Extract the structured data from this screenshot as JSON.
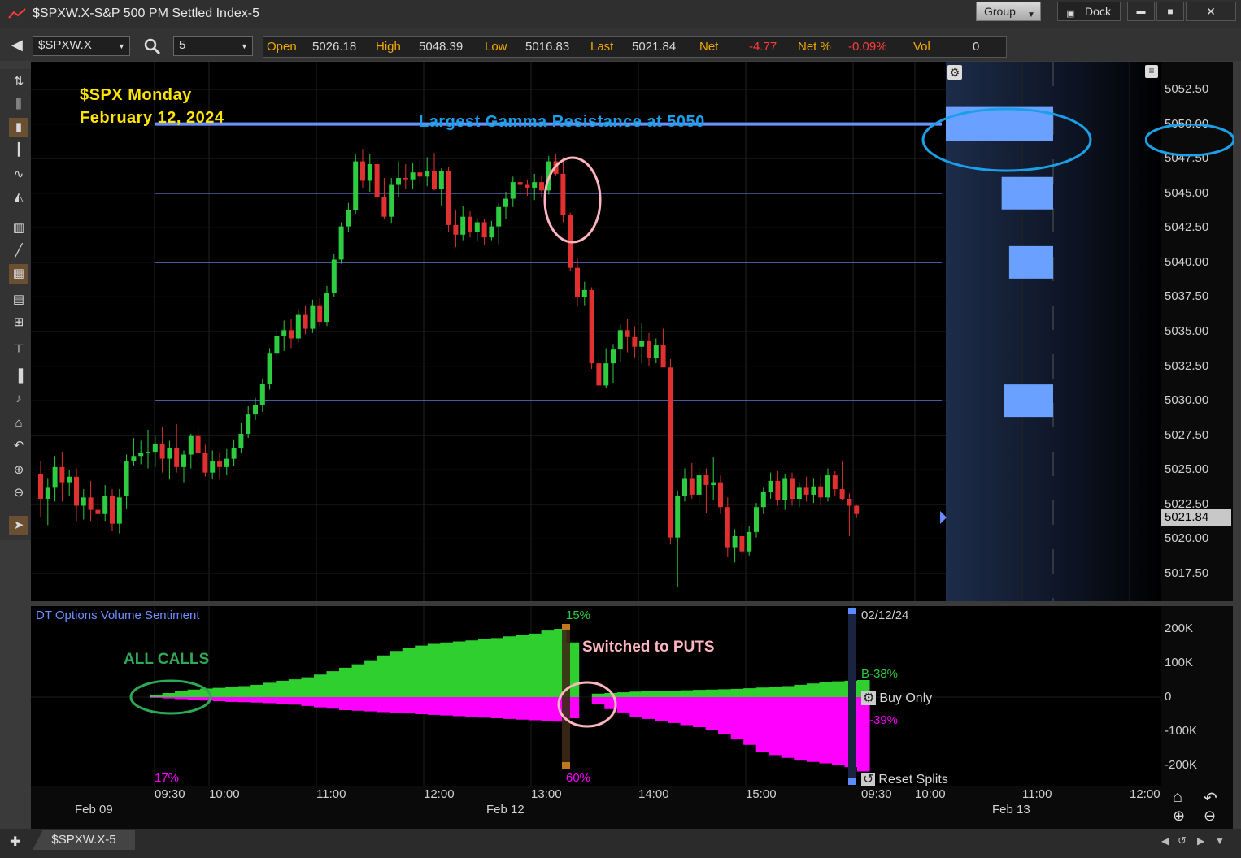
{
  "window": {
    "title": "$SPXW.X-S&P 500 PM Settled Index-5",
    "group_label": "Group",
    "dock_label": "Dock",
    "minimize": "▬",
    "maximize": "■",
    "close": "✕"
  },
  "toolbar": {
    "symbol": "$SPXW.X",
    "interval": "5",
    "quote": {
      "open_label": "Open",
      "open": "5026.18",
      "high_label": "High",
      "high": "5048.39",
      "low_label": "Low",
      "low": "5016.83",
      "last_label": "Last",
      "last": "5021.84",
      "net_label": "Net",
      "net": "-4.77",
      "netpct_label": "Net %",
      "netpct": "-0.09%",
      "vol_label": "Vol",
      "vol": "0"
    }
  },
  "annotations": {
    "title_line1": "$SPX Monday",
    "title_line2": "February 12, 2024",
    "gamma": "Largest Gamma Resistance at 5050",
    "all_calls": "ALL CALLS",
    "switched": "Switched to PUTS"
  },
  "price_axis": {
    "ticks": [
      "5052.50",
      "5050.00",
      "5047.50",
      "5045.00",
      "5042.50",
      "5040.00",
      "5037.50",
      "5035.00",
      "5032.50",
      "5030.00",
      "5027.50",
      "5025.00",
      "5022.50",
      "5020.00",
      "5017.50"
    ],
    "last_badge": "5021.84"
  },
  "sentiment": {
    "title": "DT Options Volume Sentiment",
    "pct_top": "15%",
    "pct_17": "17%",
    "pct_60": "60%",
    "date": "02/12/24",
    "b_green": "B-38%",
    "b_magenta": "B-39%",
    "buy_only": "Buy Only",
    "reset": "Reset Splits",
    "axis": [
      "200K",
      "100K",
      "0",
      "-100K",
      "-200K"
    ]
  },
  "time_axis": {
    "labels": [
      "09:30",
      "10:00",
      "11:00",
      "12:00",
      "13:00",
      "14:00",
      "15:00",
      "09:30",
      "10:00",
      "11:00",
      "12:00"
    ],
    "dates": [
      "Feb 09",
      "Feb 12",
      "Feb 13"
    ]
  },
  "bottom": {
    "tab": "$SPXW.X-5"
  },
  "colors": {
    "up": "#2ecc40",
    "down": "#e03030",
    "levels": "#6f8fff",
    "gamma_bar": "#6aa0ff",
    "calls": "#30cf30",
    "puts": "#ff00ff",
    "ellipse_blue": "#1aa0e8",
    "ellipse_pink": "#ffb6c1",
    "ellipse_green": "#2eaa55"
  },
  "chart_data": {
    "type": "candlestick",
    "price_range": [
      5015.5,
      5054.5
    ],
    "gamma_levels": [
      {
        "price": 5050,
        "size": 1.0
      },
      {
        "price": 5045,
        "size": 0.48
      },
      {
        "price": 5040,
        "size": 0.41
      },
      {
        "price": 5030,
        "size": 0.46
      }
    ],
    "candles": [
      [
        5024.7,
        5025.6,
        5021.6,
        5022.9
      ],
      [
        5022.9,
        5024.4,
        5021.0,
        5023.7
      ],
      [
        5023.7,
        5026.0,
        5022.7,
        5025.2
      ],
      [
        5025.2,
        5026.3,
        5022.7,
        5024.1
      ],
      [
        5024.1,
        5025.0,
        5023.1,
        5024.5
      ],
      [
        5024.5,
        5025.1,
        5021.3,
        5022.4
      ],
      [
        5022.4,
        5023.6,
        5021.4,
        5023.0
      ],
      [
        5023.0,
        5024.2,
        5021.3,
        5022.1
      ],
      [
        5022.1,
        5023.1,
        5020.8,
        5021.8
      ],
      [
        5021.8,
        5023.9,
        5021.3,
        5023.1
      ],
      [
        5023.1,
        5023.6,
        5020.6,
        5021.1
      ],
      [
        5021.1,
        5023.6,
        5020.4,
        5023.0
      ],
      [
        5023.1,
        5026.1,
        5022.2,
        5025.6
      ],
      [
        5025.6,
        5027.3,
        5025.3,
        5026.0
      ],
      [
        5026.0,
        5027.1,
        5025.4,
        5026.2
      ],
      [
        5026.2,
        5027.9,
        5025.1,
        5026.3
      ],
      [
        5026.3,
        5027.5,
        5025.2,
        5026.9
      ],
      [
        5026.9,
        5028.1,
        5024.8,
        5025.8
      ],
      [
        5025.8,
        5027.1,
        5024.3,
        5026.6
      ],
      [
        5026.6,
        5028.3,
        5024.8,
        5025.2
      ],
      [
        5025.2,
        5026.4,
        5024.1,
        5026.1
      ],
      [
        5026.1,
        5027.6,
        5025.1,
        5027.5
      ],
      [
        5027.5,
        5028.1,
        5026.3,
        5026.2
      ],
      [
        5026.2,
        5026.8,
        5024.5,
        5024.8
      ],
      [
        5024.8,
        5026.4,
        5024.3,
        5025.6
      ],
      [
        5025.6,
        5026.2,
        5024.3,
        5025.2
      ],
      [
        5025.2,
        5026.5,
        5024.6,
        5025.8
      ],
      [
        5025.8,
        5027.2,
        5025.3,
        5026.6
      ],
      [
        5026.6,
        5028.4,
        5026.2,
        5027.6
      ],
      [
        5027.6,
        5029.6,
        5027.3,
        5029.0
      ],
      [
        5029.0,
        5030.2,
        5028.6,
        5029.7
      ],
      [
        5029.7,
        5031.6,
        5029.2,
        5031.2
      ],
      [
        5031.2,
        5033.8,
        5030.8,
        5033.4
      ],
      [
        5033.4,
        5035.1,
        5033.0,
        5034.7
      ],
      [
        5034.7,
        5035.8,
        5033.6,
        5035.1
      ],
      [
        5035.1,
        5035.9,
        5033.8,
        5034.5
      ],
      [
        5034.5,
        5036.6,
        5034.2,
        5036.2
      ],
      [
        5036.2,
        5036.9,
        5034.8,
        5035.2
      ],
      [
        5035.2,
        5037.3,
        5034.9,
        5036.9
      ],
      [
        5036.9,
        5037.4,
        5035.4,
        5035.7
      ],
      [
        5035.7,
        5038.3,
        5035.4,
        5037.8
      ],
      [
        5037.8,
        5040.6,
        5037.5,
        5040.2
      ],
      [
        5040.2,
        5042.9,
        5039.9,
        5042.6
      ],
      [
        5042.6,
        5044.3,
        5042.2,
        5043.8
      ],
      [
        5043.8,
        5047.8,
        5043.5,
        5047.3
      ],
      [
        5047.3,
        5048.2,
        5045.4,
        5045.9
      ],
      [
        5045.9,
        5047.8,
        5045.1,
        5047.1
      ],
      [
        5047.1,
        5047.6,
        5044.2,
        5044.7
      ],
      [
        5044.7,
        5046.1,
        5043.1,
        5043.3
      ],
      [
        5043.3,
        5046.1,
        5042.8,
        5045.6
      ],
      [
        5045.6,
        5047.3,
        5044.7,
        5046.1
      ],
      [
        5046.1,
        5047.1,
        5045.3,
        5046.0
      ],
      [
        5046.0,
        5047.2,
        5045.3,
        5046.5
      ],
      [
        5046.5,
        5047.4,
        5045.6,
        5046.2
      ],
      [
        5046.2,
        5047.6,
        5045.5,
        5046.6
      ],
      [
        5046.6,
        5047.9,
        5045.2,
        5045.3
      ],
      [
        5045.3,
        5046.8,
        5044.1,
        5046.6
      ],
      [
        5046.6,
        5046.9,
        5042.2,
        5042.7
      ],
      [
        5042.7,
        5043.8,
        5041.1,
        5042.0
      ],
      [
        5042.0,
        5044.1,
        5041.6,
        5043.3
      ],
      [
        5043.3,
        5043.7,
        5041.8,
        5042.2
      ],
      [
        5042.2,
        5043.2,
        5041.5,
        5042.9
      ],
      [
        5042.9,
        5043.1,
        5041.3,
        5041.8
      ],
      [
        5041.8,
        5043.0,
        5041.6,
        5042.6
      ],
      [
        5042.6,
        5044.3,
        5041.3,
        5044.0
      ],
      [
        5044.0,
        5045.1,
        5043.1,
        5044.6
      ],
      [
        5044.6,
        5046.2,
        5044.0,
        5045.8
      ],
      [
        5045.8,
        5046.2,
        5044.8,
        5045.6
      ],
      [
        5045.6,
        5046.0,
        5044.8,
        5045.4
      ],
      [
        5045.4,
        5046.4,
        5044.5,
        5045.8
      ],
      [
        5045.8,
        5046.3,
        5044.7,
        5045.2
      ],
      [
        5045.2,
        5047.7,
        5044.9,
        5047.3
      ],
      [
        5047.3,
        5047.8,
        5046.3,
        5046.4
      ],
      [
        5046.4,
        5047.6,
        5042.9,
        5043.4
      ],
      [
        5043.4,
        5043.6,
        5039.4,
        5039.6
      ],
      [
        5039.6,
        5040.3,
        5036.8,
        5037.5
      ],
      [
        5037.5,
        5038.6,
        5036.9,
        5038.0
      ],
      [
        5038.0,
        5038.2,
        5032.3,
        5032.7
      ],
      [
        5032.7,
        5033.3,
        5030.6,
        5031.1
      ],
      [
        5031.1,
        5033.8,
        5030.9,
        5032.7
      ],
      [
        5032.7,
        5034.1,
        5031.3,
        5033.7
      ],
      [
        5033.7,
        5035.5,
        5032.8,
        5035.1
      ],
      [
        5035.1,
        5035.9,
        5033.5,
        5034.6
      ],
      [
        5034.6,
        5035.4,
        5033.1,
        5033.9
      ],
      [
        5033.9,
        5035.6,
        5032.7,
        5034.3
      ],
      [
        5034.3,
        5034.9,
        5032.5,
        5033.1
      ],
      [
        5033.1,
        5034.5,
        5032.7,
        5034.0
      ],
      [
        5034.0,
        5035.2,
        5032.7,
        5032.4
      ],
      [
        5032.4,
        5033.0,
        5019.6,
        5020.1
      ],
      [
        5020.1,
        5023.5,
        5016.5,
        5023.1
      ],
      [
        5023.1,
        5025.1,
        5022.7,
        5024.4
      ],
      [
        5024.4,
        5025.5,
        5022.9,
        5023.2
      ],
      [
        5023.2,
        5025.1,
        5022.6,
        5024.6
      ],
      [
        5024.6,
        5025.1,
        5021.9,
        5023.9
      ],
      [
        5023.9,
        5025.9,
        5022.8,
        5024.1
      ],
      [
        5024.1,
        5024.6,
        5021.8,
        5022.3
      ],
      [
        5022.3,
        5023.0,
        5018.7,
        5019.4
      ],
      [
        5019.4,
        5020.7,
        5018.3,
        5020.2
      ],
      [
        5020.2,
        5021.1,
        5018.4,
        5019.1
      ],
      [
        5019.1,
        5020.9,
        5018.8,
        5020.5
      ],
      [
        5020.5,
        5022.6,
        5020.1,
        5022.3
      ],
      [
        5022.3,
        5023.7,
        5021.8,
        5023.4
      ],
      [
        5023.4,
        5024.8,
        5022.9,
        5024.2
      ],
      [
        5024.2,
        5024.9,
        5022.4,
        5022.8
      ],
      [
        5022.8,
        5024.7,
        5022.1,
        5024.4
      ],
      [
        5024.4,
        5024.8,
        5022.4,
        5022.9
      ],
      [
        5022.9,
        5024.1,
        5022.3,
        5023.7
      ],
      [
        5023.7,
        5024.5,
        5022.7,
        5023.2
      ],
      [
        5023.2,
        5024.4,
        5022.6,
        5023.8
      ],
      [
        5023.8,
        5024.6,
        5022.4,
        5023.0
      ],
      [
        5023.0,
        5025.1,
        5022.7,
        5024.6
      ],
      [
        5024.6,
        5024.9,
        5023.1,
        5023.6
      ],
      [
        5023.6,
        5025.6,
        5022.8,
        5022.9
      ],
      [
        5022.9,
        5023.3,
        5020.2,
        5022.4
      ],
      [
        5022.4,
        5022.5,
        5021.5,
        5021.8
      ]
    ],
    "sentiment_calls_k": [
      5,
      12,
      18,
      22,
      25,
      27,
      29,
      32,
      36,
      42,
      48,
      52,
      58,
      66,
      76,
      86,
      96,
      108,
      122,
      135,
      145,
      151,
      156,
      160,
      163,
      166,
      170,
      173,
      178,
      182,
      186,
      195,
      200,
      160,
      0,
      10,
      12,
      14,
      16,
      17,
      18,
      19,
      20,
      21,
      22,
      23,
      24,
      26,
      28,
      30,
      32,
      36,
      40,
      44,
      46,
      48,
      50
    ],
    "sentiment_puts_k": [
      2,
      4,
      6,
      8,
      10,
      12,
      14,
      15,
      16,
      18,
      20,
      22,
      26,
      30,
      34,
      38,
      40,
      42,
      44,
      46,
      48,
      50,
      52,
      54,
      56,
      58,
      60,
      62,
      64,
      66,
      68,
      70,
      72,
      62,
      0,
      20,
      35,
      45,
      58,
      64,
      70,
      76,
      82,
      88,
      96,
      108,
      124,
      140,
      160,
      170,
      178,
      186,
      190,
      194,
      198,
      205,
      218
    ]
  }
}
